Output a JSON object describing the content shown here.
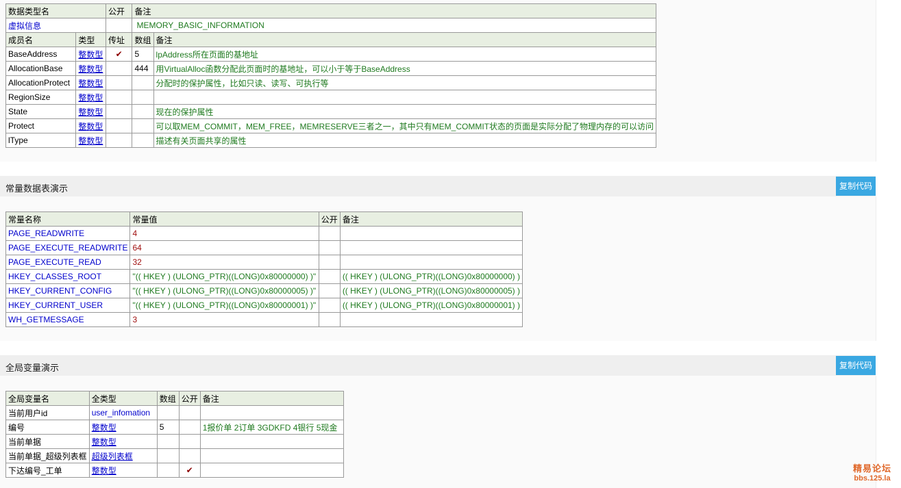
{
  "table1": {
    "header": [
      "数据类型名",
      "公开",
      "备注"
    ],
    "type_name": "虚拟信息",
    "type_note": "MEMORY_BASIC_INFORMATION",
    "member_header": [
      "成员名",
      "类型",
      "传址",
      "数组",
      "备注"
    ],
    "members": [
      {
        "name": "BaseAddress",
        "type": "整数型",
        "byref": "✔",
        "array": "5",
        "note": "lpAddress所在页面的基地址"
      },
      {
        "name": "AllocationBase",
        "type": "整数型",
        "byref": "",
        "array": "444",
        "note": "用VirtualAlloc函数分配此页面时的基地址，可以小于等于BaseAddress"
      },
      {
        "name": "AllocationProtect",
        "type": "整数型",
        "byref": "",
        "array": "",
        "note": "分配时的保护属性，比如只读、读写、可执行等"
      },
      {
        "name": "RegionSize",
        "type": "整数型",
        "byref": "",
        "array": "",
        "note": ""
      },
      {
        "name": "State",
        "type": "整数型",
        "byref": "",
        "array": "",
        "note": "现在的保护属性"
      },
      {
        "name": "Protect",
        "type": "整数型",
        "byref": "",
        "array": "",
        "note": "可以取MEM_COMMIT，MEM_FREE，MEMRESERVE三者之一，其中只有MEM_COMMIT状态的页面是实际分配了物理内存的可以访问"
      },
      {
        "name": "lType",
        "type": "整数型",
        "byref": "",
        "array": "",
        "note": "描述有关页面共享的属性"
      }
    ]
  },
  "section2": {
    "title": "常量数据表演示",
    "copy_label": "复制代码"
  },
  "table2": {
    "header": [
      "常量名称",
      "常量值",
      "公开",
      "备注"
    ],
    "rows": [
      {
        "name": "PAGE_READWRITE",
        "value": "4",
        "public": "",
        "note": ""
      },
      {
        "name": "PAGE_EXECUTE_READWRITE",
        "value": "64",
        "public": "",
        "note": ""
      },
      {
        "name": "PAGE_EXECUTE_READ",
        "value": "32",
        "public": "",
        "note": ""
      },
      {
        "name": "HKEY_CLASSES_ROOT",
        "value": "\"(( HKEY ) (ULONG_PTR)((LONG)0x80000000) )\"",
        "public": "",
        "note": "(( HKEY ) (ULONG_PTR)((LONG)0x80000000) )"
      },
      {
        "name": "HKEY_CURRENT_CONFIG",
        "value": "\"(( HKEY ) (ULONG_PTR)((LONG)0x80000005) )\"",
        "public": "",
        "note": "(( HKEY ) (ULONG_PTR)((LONG)0x80000005) )"
      },
      {
        "name": "HKEY_CURRENT_USER",
        "value": "\"(( HKEY ) (ULONG_PTR)((LONG)0x80000001) )\"",
        "public": "",
        "note": "(( HKEY ) (ULONG_PTR)((LONG)0x80000001) )"
      },
      {
        "name": "WH_GETMESSAGE",
        "value": "3",
        "public": "",
        "note": ""
      }
    ]
  },
  "section3": {
    "title": "全局变量演示",
    "copy_label": "复制代码"
  },
  "table3": {
    "header": [
      "全局变量名",
      "全类型",
      "数组",
      "公开",
      "备注"
    ],
    "rows": [
      {
        "name": "当前用户id",
        "type": "user_infomation",
        "array": "",
        "public": "",
        "note": ""
      },
      {
        "name": "编号",
        "type": "整数型",
        "array": "5",
        "public": "",
        "note": "1报价单 2订单 3GDKFD 4银行 5现金"
      },
      {
        "name": "当前单据",
        "type": "整数型",
        "array": "",
        "public": "",
        "note": ""
      },
      {
        "name": "当前单据_超级列表框",
        "type": "超级列表框",
        "array": "",
        "public": "",
        "note": ""
      },
      {
        "name": "下达编号_工单",
        "type": "整数型",
        "array": "",
        "public": "✔",
        "note": ""
      }
    ]
  },
  "watermark": {
    "line1": "精易论坛",
    "line2": "bbs.125.la"
  },
  "colors": {
    "header_bg": "#e8efe2",
    "link": "#0000cc",
    "note_green": "#1f7a1f",
    "value_red": "#a01010",
    "button": "#3aa8e2"
  }
}
